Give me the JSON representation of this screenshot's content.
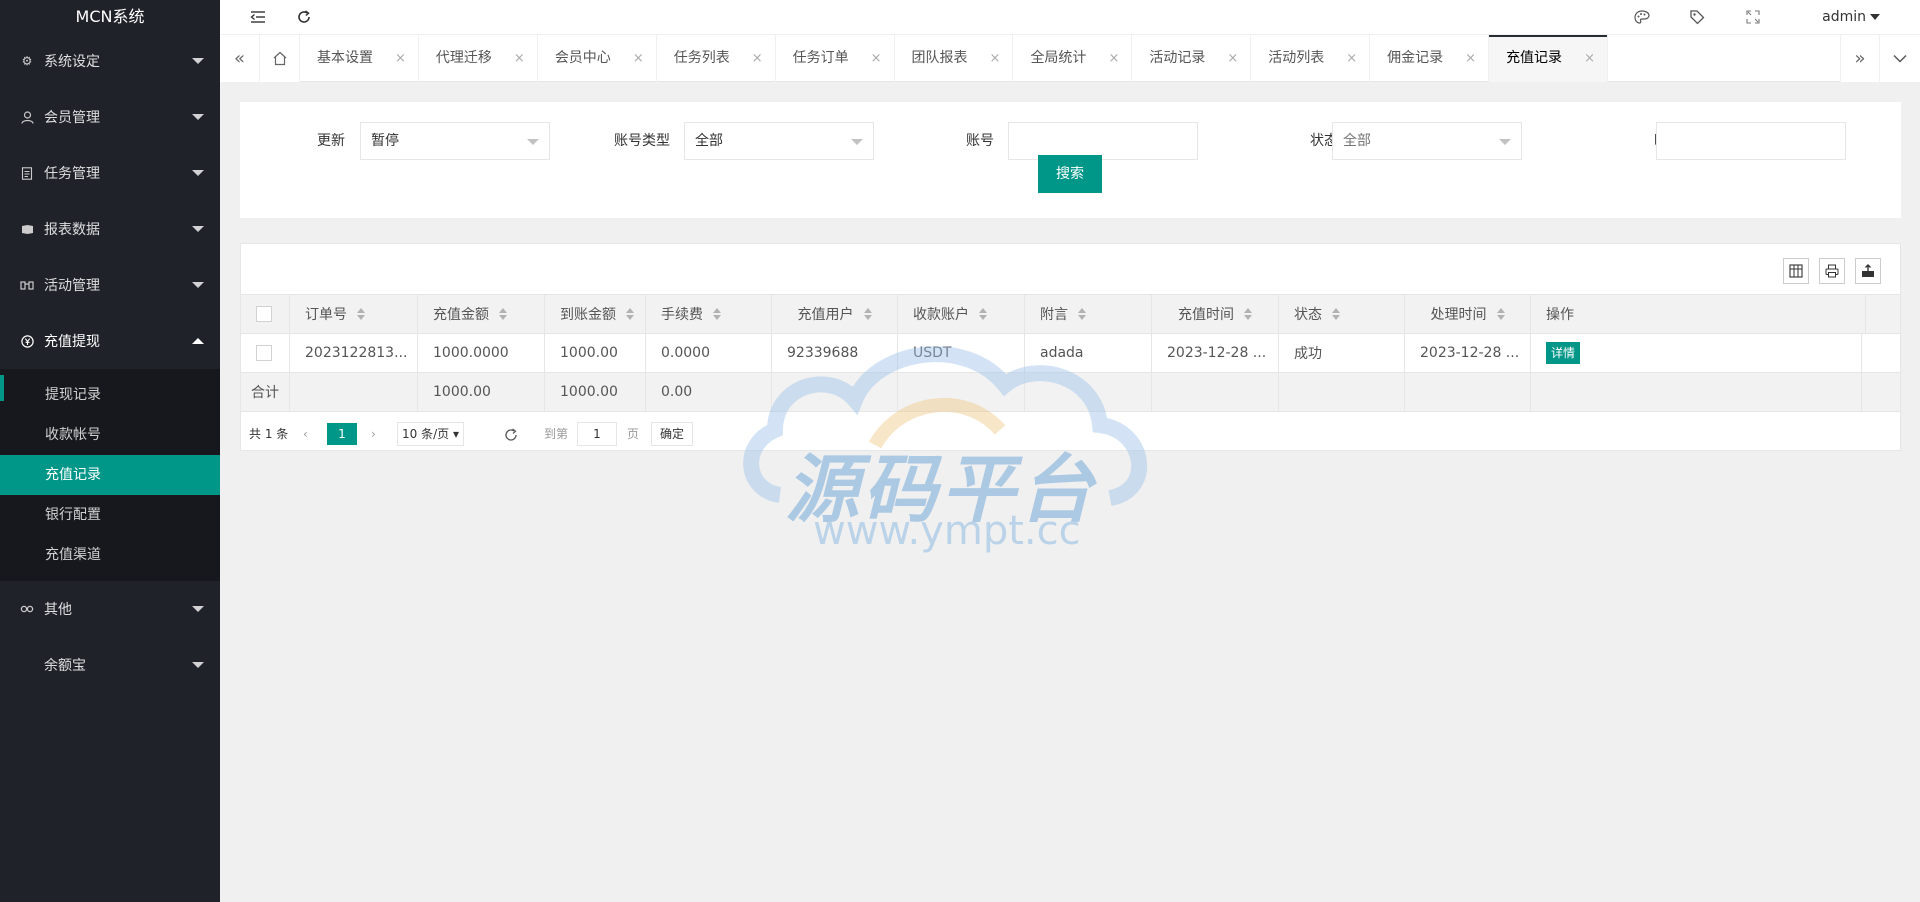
{
  "app": {
    "title": "MCN系统"
  },
  "header": {
    "user": "admin"
  },
  "sidebar": {
    "items": [
      {
        "label": "系统设定",
        "icon": "gear-icon"
      },
      {
        "label": "会员管理",
        "icon": "user-icon"
      },
      {
        "label": "任务管理",
        "icon": "document-icon"
      },
      {
        "label": "报表数据",
        "icon": "report-icon"
      },
      {
        "label": "活动管理",
        "icon": "activity-icon"
      },
      {
        "label": "充值提现",
        "icon": "yen-icon"
      },
      {
        "label": "其他",
        "icon": "link-icon"
      },
      {
        "label": "余额宝",
        "icon": "wallet-icon"
      }
    ],
    "submenu": [
      "提现记录",
      "收款帐号",
      "充值记录",
      "银行配置",
      "充值渠道"
    ]
  },
  "tabs": [
    "基本设置",
    "代理迁移",
    "会员中心",
    "任务列表",
    "任务订单",
    "团队报表",
    "全局统计",
    "活动记录",
    "活动列表",
    "佣金记录",
    "充值记录"
  ],
  "search": {
    "fields": {
      "update": {
        "label": "更新",
        "value": "暂停"
      },
      "account_type": {
        "label": "账号类型",
        "value": "全部"
      },
      "account": {
        "label": "账号",
        "value": ""
      },
      "status": {
        "label": "状态",
        "value": "全部"
      },
      "time": {
        "label": "时间",
        "value": ""
      }
    },
    "button": "搜索"
  },
  "table": {
    "columns": [
      "订单号",
      "充值金额",
      "到账金额",
      "手续费",
      "充值用户",
      "收款账户",
      "附言",
      "充值时间",
      "状态",
      "处理时间",
      "操作"
    ],
    "rows": [
      {
        "order": "2023122813...",
        "amount": "1000.0000",
        "received": "1000.00",
        "fee": "0.0000",
        "user": "92339688",
        "account": "USDT",
        "note": "adada",
        "recharge_time": "2023-12-28 ...",
        "status": "成功",
        "process_time": "2023-12-28 ...",
        "action": "详情"
      }
    ],
    "total": {
      "label": "合计",
      "amount": "1000.00",
      "received": "1000.00",
      "fee": "0.00"
    }
  },
  "pager": {
    "total_text": "共 1 条",
    "current": "1",
    "per_page": "10 条/页",
    "goto_label": "到第",
    "goto_value": "1",
    "page_label": "页",
    "confirm": "确定"
  },
  "watermark": {
    "text_cn": "源码平台",
    "text_url": "www.ympt.cc"
  },
  "colors": {
    "accent": "#009688",
    "sidebar_bg": "#20222a",
    "submenu_bg": "#17181d"
  }
}
